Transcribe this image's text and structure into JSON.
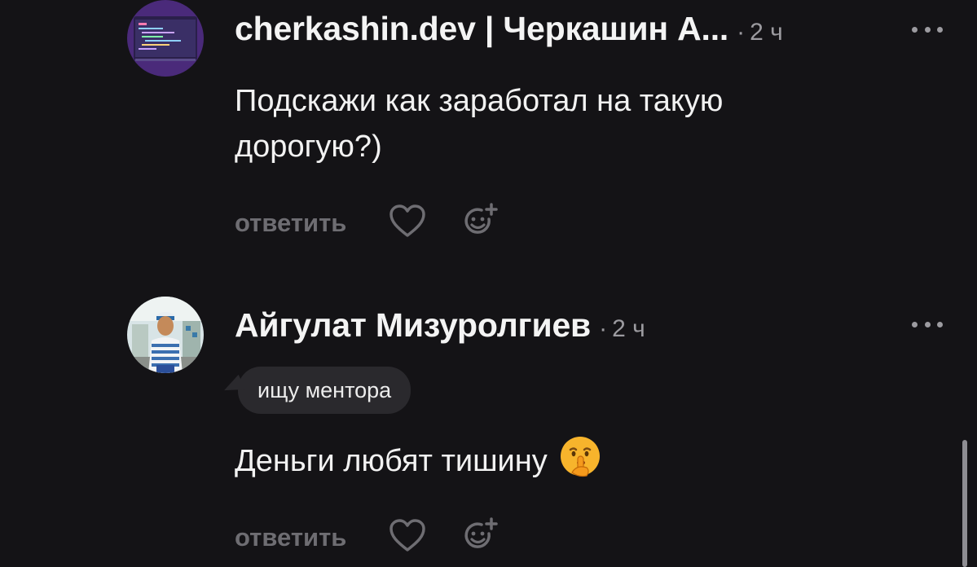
{
  "comments": [
    {
      "author": "cherkashin.dev | Черкашин А...",
      "dot": "·",
      "time": "2 ч",
      "text": "Подскажи как заработал на такую дорогую?)",
      "reply_label": "ответить",
      "avatar": "code-screen-avatar",
      "more_icon": "more-dots-icon",
      "like_icon": "heart-icon",
      "react_icon": "add-reaction-icon"
    },
    {
      "author": "Айгулат Мизуролгиев",
      "dot": "·",
      "time": "2 ч",
      "badge": "ищу ментора",
      "text": "Деньги любят тишину",
      "emoji": "shushing-face-emoji",
      "reply_label": "ответить",
      "avatar": "person-photo-avatar",
      "more_icon": "more-dots-icon",
      "like_icon": "heart-icon",
      "react_icon": "add-reaction-icon"
    }
  ],
  "colors": {
    "background": "#141316",
    "text": "#f2f2f2",
    "muted": "#9c9ba0",
    "action": "#6e6d72",
    "badge_bg": "#2a292d"
  }
}
